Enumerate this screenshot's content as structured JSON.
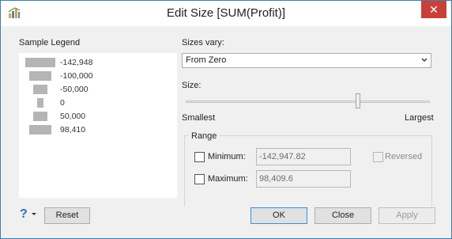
{
  "window": {
    "title": "Edit Size [SUM(Profit)]",
    "close_glyph": "✕",
    "app_icon": "tableau-chart-icon"
  },
  "legend": {
    "label": "Sample Legend",
    "items": [
      {
        "label": "-142,948"
      },
      {
        "label": "-100,000"
      },
      {
        "label": "-50,000"
      },
      {
        "label": "0"
      },
      {
        "label": "50,000"
      },
      {
        "label": "98,410"
      }
    ]
  },
  "sizes_vary": {
    "label": "Sizes vary:",
    "selected": "From Zero"
  },
  "size": {
    "label": "Size:",
    "smallest_label": "Smallest",
    "largest_label": "Largest",
    "slider_level": 0.7
  },
  "range": {
    "title": "Range",
    "minimum_label": "Minimum:",
    "minimum_value": "-142,947.82",
    "maximum_label": "Maximum:",
    "maximum_value": "98,409.6",
    "reversed_label": "Reversed"
  },
  "buttons": {
    "help_glyph": "?",
    "reset": "Reset",
    "ok": "OK",
    "close": "Close",
    "apply": "Apply"
  },
  "colors": {
    "close_button": "#c7413a",
    "legend_bar": "#b5b5b5",
    "default_button_border": "#3c8ed6"
  }
}
